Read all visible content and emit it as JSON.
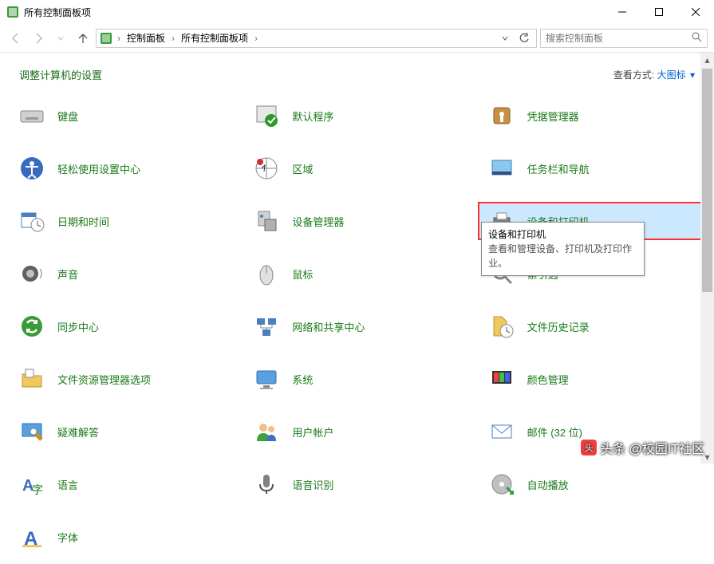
{
  "window": {
    "title": "所有控制面板项"
  },
  "breadcrumb": {
    "root": "控制面板",
    "current": "所有控制面板项"
  },
  "search": {
    "placeholder": "搜索控制面板"
  },
  "subheader": {
    "heading": "调整计算机的设置",
    "viewby_label": "查看方式:",
    "viewby_value": "大图标"
  },
  "items": [
    {
      "label": "键盘",
      "icon": "keyboard"
    },
    {
      "label": "默认程序",
      "icon": "defaults"
    },
    {
      "label": "凭据管理器",
      "icon": "credentials"
    },
    {
      "label": "轻松使用设置中心",
      "icon": "ease"
    },
    {
      "label": "区域",
      "icon": "region"
    },
    {
      "label": "任务栏和导航",
      "icon": "taskbar"
    },
    {
      "label": "日期和时间",
      "icon": "datetime"
    },
    {
      "label": "设备管理器",
      "icon": "devmgr"
    },
    {
      "label": "设备和打印机",
      "icon": "printers",
      "highlight": true
    },
    {
      "label": "声音",
      "icon": "sound"
    },
    {
      "label": "鼠标",
      "icon": "mouse"
    },
    {
      "label": "索引选",
      "icon": "indexing"
    },
    {
      "label": "同步中心",
      "icon": "sync"
    },
    {
      "label": "网络和共享中心",
      "icon": "network"
    },
    {
      "label": "文件历史记录",
      "icon": "history"
    },
    {
      "label": "文件资源管理器选项",
      "icon": "folder"
    },
    {
      "label": "系统",
      "icon": "system"
    },
    {
      "label": "颜色管理",
      "icon": "color"
    },
    {
      "label": "疑难解答",
      "icon": "troubleshoot"
    },
    {
      "label": "用户帐户",
      "icon": "users"
    },
    {
      "label": "邮件 (32 位)",
      "icon": "mail"
    },
    {
      "label": "语言",
      "icon": "language"
    },
    {
      "label": "语音识别",
      "icon": "speech"
    },
    {
      "label": "自动播放",
      "icon": "autoplay"
    },
    {
      "label": "字体",
      "icon": "fonts"
    }
  ],
  "tooltip": {
    "title": "设备和打印机",
    "desc": "查看和管理设备、打印机及打印作业。"
  },
  "watermark": "头条 @校园IT社区"
}
